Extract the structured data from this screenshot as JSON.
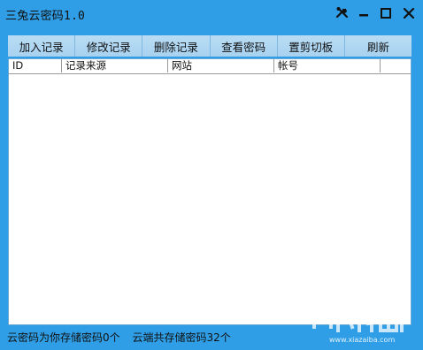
{
  "window": {
    "title": "三兔云密码1.0"
  },
  "titlebar": {
    "buttons": [
      {
        "name": "settings",
        "icon": "tools-icon"
      },
      {
        "name": "minimize",
        "icon": "minimize-icon"
      },
      {
        "name": "maximize",
        "icon": "maximize-icon"
      },
      {
        "name": "close",
        "icon": "close-icon"
      }
    ]
  },
  "toolbar": {
    "buttons": [
      {
        "label": "加入记录"
      },
      {
        "label": "修改记录"
      },
      {
        "label": "删除记录"
      },
      {
        "label": "查看密码"
      },
      {
        "label": "置剪切板"
      },
      {
        "label": "刷新"
      }
    ]
  },
  "table": {
    "columns": [
      "ID",
      "记录来源",
      "网站",
      "帐号",
      ""
    ],
    "rows": []
  },
  "status": {
    "local": "云密码为你存储密码0个",
    "cloud": "云端共存储密码32个"
  },
  "watermark": {
    "url": "www.xiazaiba.com"
  },
  "colors": {
    "background": "#2f9ee6",
    "toolbar_button": "#b9dcf4",
    "list_background": "#ffffff"
  }
}
